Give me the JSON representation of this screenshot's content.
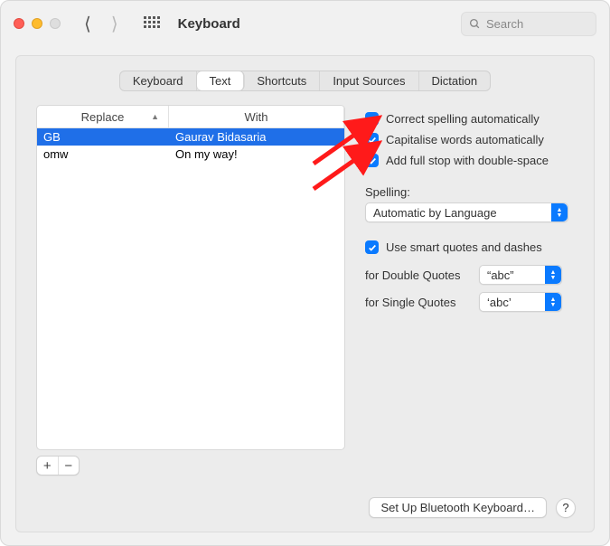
{
  "window": {
    "title": "Keyboard"
  },
  "search": {
    "placeholder": "Search"
  },
  "tabs": [
    "Keyboard",
    "Text",
    "Shortcuts",
    "Input Sources",
    "Dictation"
  ],
  "active_tab": "Text",
  "table": {
    "headers": {
      "replace": "Replace",
      "with": "With"
    },
    "rows": [
      {
        "replace": "GB",
        "with": "Gaurav Bidasaria",
        "selected": true
      },
      {
        "replace": "omw",
        "with": "On my way!",
        "selected": false
      }
    ]
  },
  "options": {
    "correct_spelling": {
      "label": "Correct spelling automatically",
      "checked": true
    },
    "capitalise_words": {
      "label": "Capitalise words automatically",
      "checked": true
    },
    "full_stop_double": {
      "label": "Add full stop with double-space",
      "checked": true
    },
    "spelling_label": "Spelling:",
    "spelling_value": "Automatic by Language",
    "smart_quotes": {
      "label": "Use smart quotes and dashes",
      "checked": true
    },
    "double_quotes_label": "for Double Quotes",
    "double_quotes_value": "“abc”",
    "single_quotes_label": "for Single Quotes",
    "single_quotes_value": "‘abc’"
  },
  "bottom_button": "Set Up Bluetooth Keyboard…",
  "help_label": "?"
}
